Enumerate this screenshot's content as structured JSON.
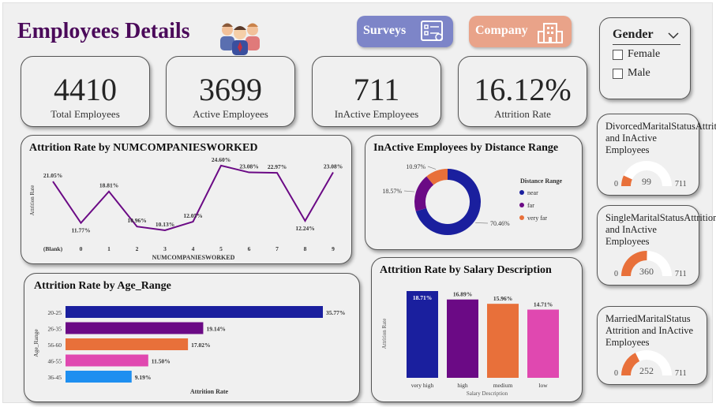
{
  "header": {
    "title": "Employees Details"
  },
  "nav": {
    "surveys_label": "Surveys",
    "company_label": "Company"
  },
  "kpis": [
    {
      "value": "4410",
      "label": "Total Employees"
    },
    {
      "value": "3699",
      "label": "Active Employees"
    },
    {
      "value": "711",
      "label": "InActive Employees"
    },
    {
      "value": "16.12%",
      "label": "Attrition Rate"
    }
  ],
  "filter": {
    "title": "Gender",
    "options": [
      "Female",
      "Male"
    ]
  },
  "colors": {
    "navy": "#1a1f9e",
    "purple": "#6b0a85",
    "orange": "#e8703a",
    "pink": "#e048b0",
    "blue": "#1e8ff0",
    "line": "#6b0a85"
  },
  "chart_data": [
    {
      "type": "line",
      "title": "Attrition Rate by NUMCOMPANIESWORKED",
      "xlabel": "NUMCOMPANIESWORKED",
      "ylabel": "Attrition Rate",
      "categories": [
        "(Blank)",
        "0",
        "1",
        "2",
        "3",
        "4",
        "5",
        "6",
        "7",
        "8",
        "9"
      ],
      "values": [
        21.05,
        11.77,
        18.81,
        10.96,
        10.13,
        12.05,
        24.6,
        23.08,
        22.97,
        12.24,
        23.08
      ],
      "labels": [
        "21.05%",
        "11.77%",
        "18.81%",
        "10.96%",
        "10.13%",
        "12.05%",
        "24.60%",
        "23.08%",
        "22.97%",
        "12.24%",
        "23.08%"
      ]
    },
    {
      "type": "pie",
      "title": "InActive Employees by Distance Range",
      "legend_title": "Distance Range",
      "slices": [
        {
          "name": "near",
          "value": 70.46,
          "label": "70.46%"
        },
        {
          "name": "far",
          "value": 18.57,
          "label": "18.57%"
        },
        {
          "name": "very far",
          "value": 10.97,
          "label": "10.97%"
        }
      ]
    },
    {
      "type": "bar",
      "orientation": "horizontal",
      "title": "Attrition Rate by Age_Range",
      "xlabel": "Attrition Rate",
      "ylabel": "Age_Range",
      "categories": [
        "20-25",
        "26-35",
        "56-60",
        "46-55",
        "36-45"
      ],
      "values": [
        35.77,
        19.14,
        17.02,
        11.5,
        9.19
      ],
      "labels": [
        "35.77%",
        "19.14%",
        "17.02%",
        "11.50%",
        "9.19%"
      ]
    },
    {
      "type": "bar",
      "title": "Attrition Rate by Salary Description",
      "xlabel": "Salary Description",
      "ylabel": "Attrition Rate",
      "categories": [
        "very high",
        "high",
        "medium",
        "low"
      ],
      "values": [
        18.71,
        16.89,
        15.96,
        14.71
      ],
      "labels": [
        "18.71%",
        "16.89%",
        "15.96%",
        "14.71%"
      ]
    }
  ],
  "gauges": [
    {
      "title": "DivorcedMaritalStatusAttrition and InActive Employees",
      "value": 99,
      "value_label": "99",
      "min": "0",
      "max": "711",
      "max_value": 711
    },
    {
      "title": "SingleMaritalStatusAttrition and InActive Employees",
      "value": 360,
      "value_label": "360",
      "min": "0",
      "max": "711",
      "max_value": 711
    },
    {
      "title": "MarriedMaritalStatus Attrition and InActive Employees",
      "value": 252,
      "value_label": "252",
      "min": "0",
      "max": "711",
      "max_value": 711
    }
  ]
}
